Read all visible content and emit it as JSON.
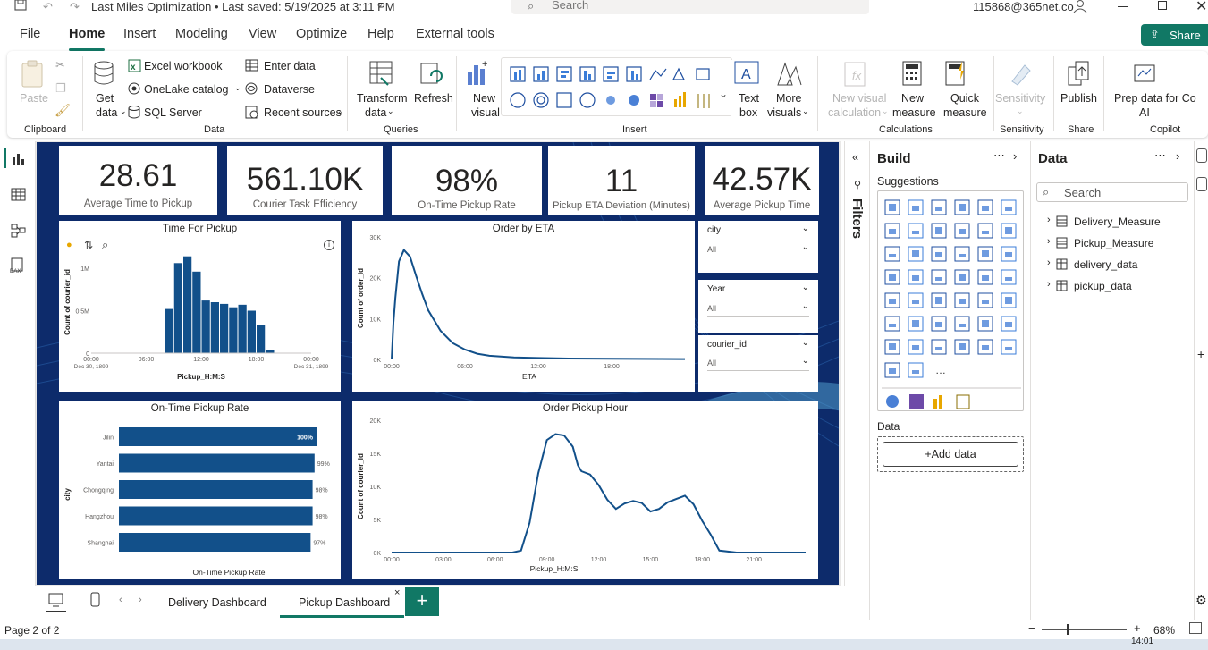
{
  "titlebar": {
    "doc_title": "Last Miles Optimization • Last saved: 5/19/2025 at 3:11 PM",
    "search_placeholder": "Search",
    "user": "115868@365net.co"
  },
  "menu": [
    "File",
    "Home",
    "Insert",
    "Modeling",
    "View",
    "Optimize",
    "Help",
    "External tools"
  ],
  "share_label": "Share",
  "ribbon": {
    "clipboard": {
      "paste": "Paste",
      "title": "Clipboard"
    },
    "data": {
      "get_data": "Get",
      "get_data2": "data",
      "excel": "Excel workbook",
      "onelake": "OneLake catalog",
      "sql": "SQL Server",
      "enter": "Enter data",
      "dataverse": "Dataverse",
      "recent": "Recent sources",
      "title": "Data"
    },
    "queries": {
      "transform": "Transform",
      "transform2": "data",
      "refresh": "Refresh",
      "title": "Queries"
    },
    "insert": {
      "new_visual": "New",
      "new_visual2": "visual",
      "text_box": "Text",
      "text_box2": "box",
      "more": "More",
      "more2": "visuals",
      "title": "Insert"
    },
    "calculations": {
      "new_visual_calc": "New visual",
      "new_visual_calc2": "calculation",
      "new_measure": "New",
      "new_measure2": "measure",
      "quick": "Quick",
      "quick2": "measure",
      "title": "Calculations"
    },
    "sensitivity": {
      "label": "Sensitivity",
      "title": "Sensitivity"
    },
    "share": {
      "publish": "Publish",
      "title": "Share"
    },
    "copilot": {
      "prep": "Prep data for Co",
      "prep2": "AI",
      "title": "Copilot"
    }
  },
  "kpis": [
    {
      "value": "28.61",
      "label": "Average Time to Pickup"
    },
    {
      "value": "561.10K",
      "label": "Courier Task Efficiency"
    },
    {
      "value": "98%",
      "label": "On-Time Pickup Rate"
    },
    {
      "value": "11",
      "label": "Pickup ETA Deviation (Minutes)"
    },
    {
      "value": "42.57K",
      "label": "Average Pickup Time"
    }
  ],
  "slicers": [
    {
      "label": "city",
      "value": "All"
    },
    {
      "label": "Year",
      "value": "All"
    },
    {
      "label": "courier_id",
      "value": "All"
    }
  ],
  "chart_data": [
    {
      "type": "bar",
      "title": "Time For Pickup",
      "xlabel": "Pickup_H:M:S",
      "ylabel": "Count of courier_id",
      "x_ticks": [
        "00:00",
        "06:00",
        "12:00",
        "18:00",
        "00:00"
      ],
      "x_ticks_sub": [
        "Dec 30, 1899",
        "",
        "",
        "",
        "Dec 31, 1899"
      ],
      "y_ticks": [
        "0",
        "0.5M",
        "1M"
      ],
      "ylim": [
        0,
        1200000
      ],
      "bin_hours": [
        8.5,
        9.5,
        10.5,
        11.5,
        12.5,
        13.5,
        14.5,
        15.5,
        16.5,
        17.5,
        18.5,
        19.5
      ],
      "values": [
        520000,
        1060000,
        1140000,
        960000,
        620000,
        600000,
        580000,
        540000,
        570000,
        500000,
        330000,
        40000
      ]
    },
    {
      "type": "line",
      "title": "Order by ETA",
      "xlabel": "ETA",
      "ylabel": "Count of order_id",
      "x_ticks": [
        "00:00",
        "06:00",
        "12:00",
        "18:00"
      ],
      "y_ticks": [
        "0K",
        "10K",
        "20K",
        "30K"
      ],
      "ylim": [
        0,
        30000
      ],
      "x_hours": [
        0,
        0.15,
        0.3,
        0.6,
        1,
        1.5,
        2,
        2.5,
        3,
        4,
        5,
        6,
        7,
        8,
        10,
        12,
        14,
        18,
        22,
        24
      ],
      "y": [
        0,
        9000,
        15000,
        24000,
        26800,
        25200,
        20500,
        16000,
        12000,
        7000,
        4000,
        2400,
        1400,
        900,
        500,
        350,
        250,
        150,
        100,
        80
      ]
    },
    {
      "type": "bar",
      "title": "On-Time Pickup Rate",
      "xlabel": "On-Time Pickup Rate",
      "ylabel": "city",
      "categories": [
        "Jilin",
        "Yantai",
        "Chongqing",
        "Hangzhou",
        "Shanghai"
      ],
      "values": [
        100,
        99,
        98,
        98,
        97
      ],
      "labels": [
        "100%",
        "99%",
        "98%",
        "98%",
        "97%"
      ],
      "xlim": [
        0,
        100
      ]
    },
    {
      "type": "line",
      "title": "Order Pickup Hour",
      "xlabel": "Pickup_H:M:S",
      "ylabel": "Count of courier_id",
      "x_ticks": [
        "00:00",
        "03:00",
        "06:00",
        "09:00",
        "12:00",
        "15:00",
        "18:00",
        "21:00"
      ],
      "y_ticks": [
        "0K",
        "5K",
        "10K",
        "15K",
        "20K"
      ],
      "ylim": [
        0,
        20000
      ],
      "x_hours": [
        0,
        7,
        7.5,
        8,
        8.5,
        9,
        9.5,
        10,
        10.5,
        10.8,
        11,
        11.5,
        12,
        12.5,
        13,
        13.5,
        14,
        14.5,
        15,
        15.5,
        16,
        16.5,
        17,
        17.5,
        18,
        18.5,
        19,
        20,
        22,
        24
      ],
      "y": [
        0,
        0,
        300,
        4500,
        12000,
        17000,
        17900,
        17700,
        16000,
        13200,
        12300,
        11800,
        10200,
        8000,
        6600,
        7400,
        7800,
        7500,
        6200,
        6600,
        7600,
        8100,
        8600,
        7300,
        4800,
        2700,
        300,
        0,
        0,
        0
      ]
    }
  ],
  "panes": {
    "filters": "Filters",
    "build": "Build",
    "suggestions": "Suggestions",
    "data_label": "Data",
    "add_data": "+Add data",
    "data_title": "Data",
    "search_placeholder": "Search",
    "tables": [
      "Delivery_Measure",
      "Pickup_Measure",
      "delivery_data",
      "pickup_data"
    ]
  },
  "tabs": [
    "Delivery Dashboard",
    "Pickup Dashboard"
  ],
  "status": {
    "page": "Page 2 of 2",
    "zoom": "68%",
    "time": "14:01"
  },
  "colors": {
    "accent": "#117865",
    "bar": "#12508a",
    "report_bg": "#0d2b6b"
  }
}
